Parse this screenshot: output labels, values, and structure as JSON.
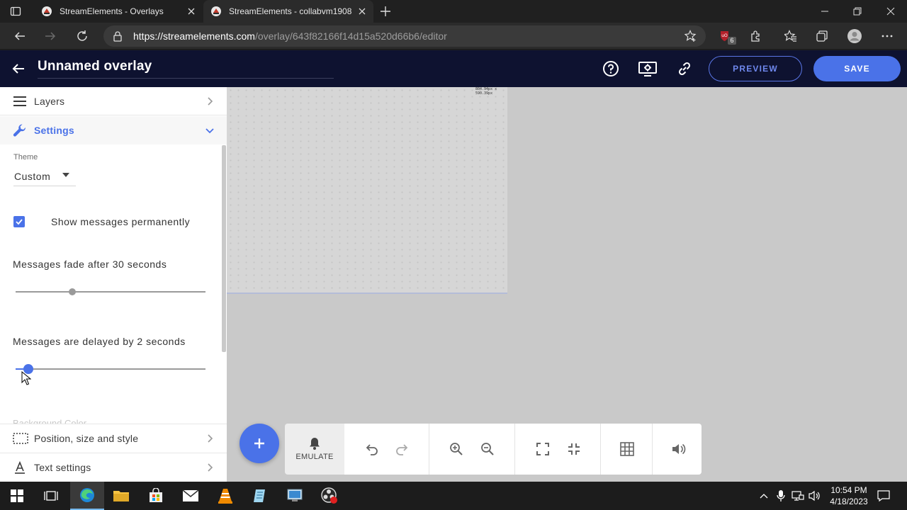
{
  "browser": {
    "tabs": [
      {
        "title": "StreamElements - Overlays",
        "active": false
      },
      {
        "title": "StreamElements - collabvm1908",
        "active": true
      }
    ],
    "url_host": "https://streamelements.com",
    "url_path": "/overlay/643f82166f14d15a520d66b6/editor",
    "extension_badge": "6"
  },
  "header": {
    "title": "Unnamed overlay",
    "preview_label": "PREVIEW",
    "save_label": "SAVE"
  },
  "panel": {
    "layers_label": "Layers",
    "settings_label": "Settings",
    "theme_label": "Theme",
    "theme_value": "Custom",
    "show_permanent_label": "Show messages permanently",
    "show_permanent_checked": true,
    "fade_label": "Messages fade after 30 seconds",
    "fade_value": 30,
    "delay_label": "Messages are delayed by 2 seconds",
    "delay_value": 2,
    "ghost_label": "Background Color",
    "position_label": "Position, size and style",
    "text_label": "Text settings"
  },
  "canvas": {
    "resolution_label": "804.94px x 590.39px",
    "emulate_label": "EMULATE"
  },
  "taskbar": {
    "time": "10:54 PM",
    "date": "4/18/2023"
  },
  "colors": {
    "accent": "#4a72e8",
    "header_bg": "#0e1230"
  }
}
